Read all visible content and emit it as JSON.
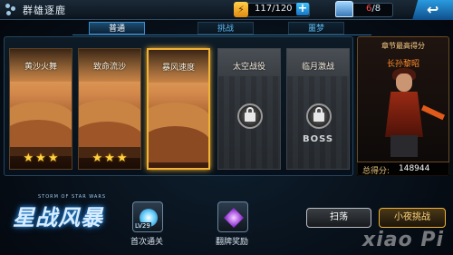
{
  "header": {
    "title": "群雄逐鹿",
    "energy": "117/120",
    "chest_current": "6",
    "chest_total": "/8",
    "back_icon": "back-arrow-icon"
  },
  "tabs": [
    {
      "label": "普通",
      "active": true
    },
    {
      "label": "挑战",
      "active": false
    },
    {
      "label": "噩梦",
      "active": false
    }
  ],
  "stages": [
    {
      "name": "黄沙火舞",
      "stars": 3,
      "locked": false,
      "selected": false
    },
    {
      "name": "致命流沙",
      "stars": 3,
      "locked": false,
      "selected": false
    },
    {
      "name": "暴风速度",
      "stars": 0,
      "locked": false,
      "selected": true
    },
    {
      "name": "太空战役",
      "stars": 0,
      "locked": true,
      "selected": false
    },
    {
      "name": "临月激战",
      "stars": 0,
      "locked": true,
      "selected": false,
      "boss_label": "BOSS"
    }
  ],
  "hero": {
    "header": "章节最高得分",
    "name": "长孙黎昭",
    "score_label": "总得分:",
    "score": "148944"
  },
  "logo": {
    "subtitle": "STORM OF STAR WARS",
    "title": "星战风暴"
  },
  "rewards": [
    {
      "label": "首次通关",
      "level": "LV29",
      "icon": "first-clear-reward-icon"
    },
    {
      "label": "翻牌奖励",
      "icon": "flip-card-reward-icon"
    }
  ],
  "buttons": {
    "sweep": "扫荡",
    "challenge": "小夜挑战"
  },
  "watermark": "xiao Pi"
}
